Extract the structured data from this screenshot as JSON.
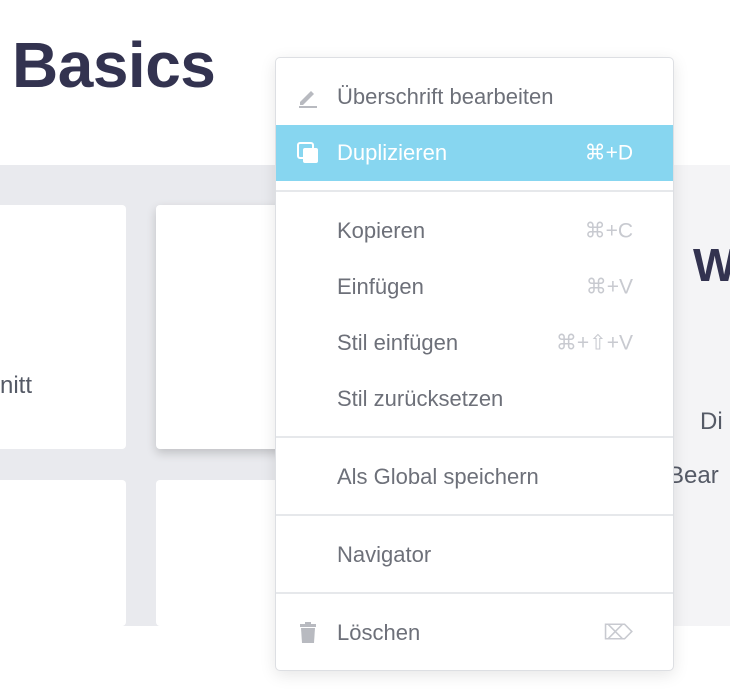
{
  "page": {
    "title": "Basics",
    "card_label": "nitt",
    "right_heading": "W",
    "right_text_line1": "Di",
    "right_text_line2": "Bear"
  },
  "context_menu": {
    "items": [
      {
        "label": "Überschrift bearbeiten",
        "shortcut": "",
        "icon": "pencil-icon"
      },
      {
        "label": "Duplizieren",
        "shortcut": "⌘+D",
        "icon": "duplicate-icon",
        "active": true
      },
      {
        "label": "Kopieren",
        "shortcut": "⌘+C"
      },
      {
        "label": "Einfügen",
        "shortcut": "⌘+V"
      },
      {
        "label": "Stil einfügen",
        "shortcut": "⌘+⇧+V"
      },
      {
        "label": "Stil zurücksetzen",
        "shortcut": ""
      },
      {
        "label": "Als Global speichern",
        "shortcut": ""
      },
      {
        "label": "Navigator",
        "shortcut": ""
      },
      {
        "label": "Löschen",
        "shortcut": "⌦",
        "icon": "trash-icon"
      }
    ]
  },
  "colors": {
    "active_bg": "#87d6f0",
    "title": "#333350",
    "menu_text": "#6d7079",
    "shortcut_text": "#c8cad0"
  }
}
